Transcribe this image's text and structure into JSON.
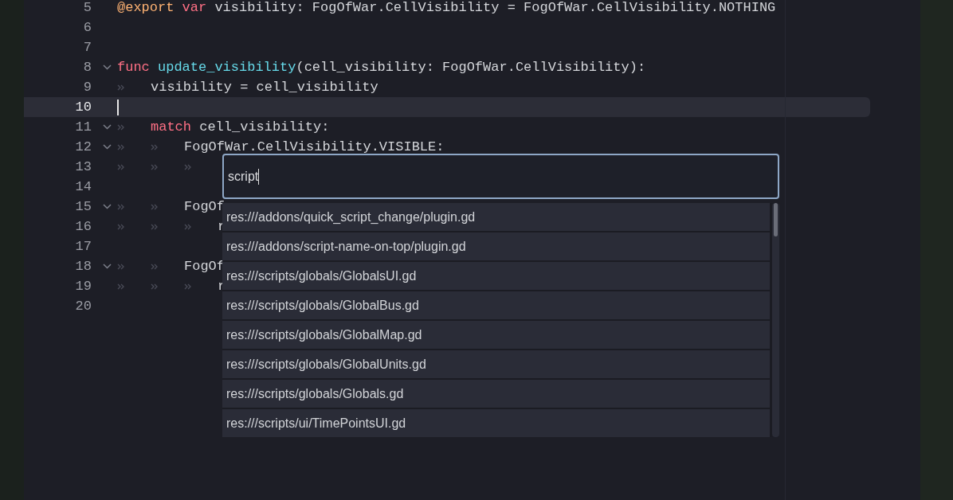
{
  "editor": {
    "lines": [
      {
        "number": "5",
        "current": false,
        "foldable": false,
        "tokens": [
          {
            "text": "@export",
            "kind": "annotation"
          },
          {
            "text": "var",
            "kind": "keyword",
            "spaced": true
          },
          {
            "text": "visibility: FogOfWar.CellVisibility = FogOfWar.CellVisibility.NOTHING",
            "kind": "plain",
            "spaced": true
          }
        ]
      },
      {
        "number": "6",
        "current": false,
        "foldable": false
      },
      {
        "number": "7",
        "current": false,
        "foldable": false
      },
      {
        "number": "8",
        "current": false,
        "foldable": true,
        "tokens": [
          {
            "text": "func",
            "kind": "keyword"
          },
          {
            "text": "update_visibility",
            "kind": "function",
            "spaced": true
          },
          {
            "text": "(cell_visibility: FogOfWar.CellVisibility):",
            "kind": "plain"
          }
        ]
      },
      {
        "number": "9",
        "current": false,
        "foldable": false,
        "indent": [
          {
            "marker": true
          }
        ],
        "tokens": [
          {
            "text": "visibility = cell_visibility",
            "kind": "plain"
          }
        ]
      },
      {
        "number": "10",
        "current": true,
        "foldable": false
      },
      {
        "number": "11",
        "current": false,
        "foldable": true,
        "indent": [
          {
            "marker": true
          }
        ],
        "tokens": [
          {
            "text": "match",
            "kind": "keyword"
          },
          {
            "text": "cell_visibility:",
            "kind": "plain",
            "spaced": true
          }
        ]
      },
      {
        "number": "12",
        "current": false,
        "foldable": true,
        "indent": [
          {
            "marker": true
          },
          {
            "marker": true
          }
        ],
        "tokens": [
          {
            "text": "FogOfWar.CellVisibility.VISIBLE:",
            "kind": "plain"
          }
        ]
      },
      {
        "number": "13",
        "current": false,
        "foldable": false,
        "indent": [
          {
            "marker": true
          },
          {
            "marker": true
          },
          {
            "marker": true
          }
        ]
      },
      {
        "number": "14",
        "current": false,
        "foldable": false
      },
      {
        "number": "15",
        "current": false,
        "foldable": true,
        "indent": [
          {
            "marker": true
          },
          {
            "marker": true
          }
        ],
        "tokens": [
          {
            "text": "FogOf",
            "kind": "plain"
          }
        ]
      },
      {
        "number": "16",
        "current": false,
        "foldable": false,
        "indent": [
          {
            "marker": true
          },
          {
            "marker": true
          },
          {
            "marker": true
          }
        ],
        "tokens": [
          {
            "text": "r",
            "kind": "plain"
          }
        ]
      },
      {
        "number": "17",
        "current": false,
        "foldable": false
      },
      {
        "number": "18",
        "current": false,
        "foldable": true,
        "indent": [
          {
            "marker": true
          },
          {
            "marker": true
          }
        ],
        "tokens": [
          {
            "text": "FogOf",
            "kind": "plain"
          }
        ]
      },
      {
        "number": "19",
        "current": false,
        "foldable": false,
        "indent": [
          {
            "marker": true
          },
          {
            "marker": true
          },
          {
            "marker": true
          }
        ],
        "tokens": [
          {
            "text": "r",
            "kind": "plain"
          }
        ]
      },
      {
        "number": "20",
        "current": false,
        "foldable": false
      }
    ]
  },
  "quick_open": {
    "search": {
      "value": "script"
    },
    "results": [
      {
        "text": "res:///addons/quick_script_change/plugin.gd",
        "selected": false
      },
      {
        "text": "res:///addons/script-name-on-top/plugin.gd",
        "selected": false
      },
      {
        "text": "res:///scripts/globals/GlobalsUI.gd",
        "selected": false
      },
      {
        "text": "res:///scripts/globals/GlobalBus.gd",
        "selected": false
      },
      {
        "text": "res:///scripts/globals/GlobalMap.gd",
        "selected": false
      },
      {
        "text": "res:///scripts/globals/GlobalUnits.gd",
        "selected": false
      },
      {
        "text": "res:///scripts/globals/Globals.gd",
        "selected": false
      },
      {
        "text": "res:///scripts/ui/TimePointsUI.gd",
        "selected": false
      }
    ]
  }
}
